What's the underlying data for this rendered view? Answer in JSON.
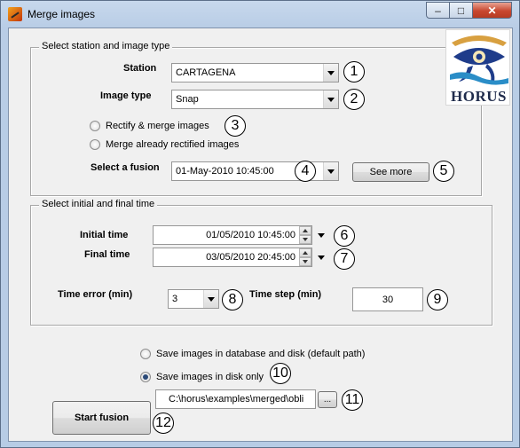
{
  "window": {
    "title": "Merge images",
    "minimize_glyph": "‒",
    "maximize_glyph": "□",
    "close_glyph": "✕"
  },
  "logo": {
    "text": "HORUS"
  },
  "station_panel": {
    "title": "Select station and image type",
    "station_label": "Station",
    "station_value": "CARTAGENA",
    "image_type_label": "Image type",
    "image_type_value": "Snap",
    "radio_rectify": "Rectify & merge images",
    "radio_merge_rectified": "Merge already rectified images",
    "fusion_label": "Select a fusion",
    "fusion_value": "01-May-2010 10:45:00",
    "see_more_label": "See more"
  },
  "time_panel": {
    "title": "Select initial and final time",
    "initial_label": "Initial time",
    "initial_value": "01/05/2010 10:45:00",
    "final_label": "Final time",
    "final_value": "03/05/2010 20:45:00",
    "time_error_label": "Time error (min)",
    "time_error_value": "3",
    "time_step_label": "Time step (min)",
    "time_step_value": "30"
  },
  "save_options": {
    "db_and_disk": "Save images in database and disk (default path)",
    "disk_only": "Save images in disk only",
    "path_value": "C:\\horus\\examples\\merged\\obli",
    "browse_label": "...",
    "selected": "disk_only"
  },
  "start_button_label": "Start fusion",
  "markers": [
    "1",
    "2",
    "3",
    "4",
    "5",
    "6",
    "7",
    "8",
    "9",
    "10",
    "11",
    "12"
  ]
}
